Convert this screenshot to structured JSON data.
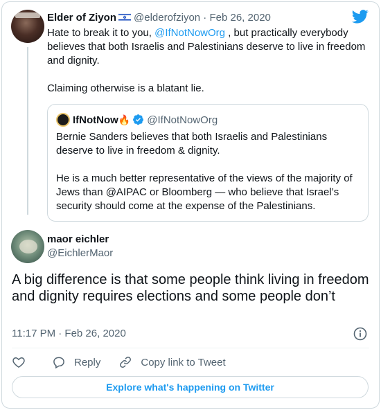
{
  "parent_tweet": {
    "author_name": "Elder of Ziyon",
    "author_flag": "israel-flag-icon",
    "handle": "@elderofziyon",
    "separator": "·",
    "date": "Feb 26, 2020",
    "text_intro": "Hate to break it to you,",
    "mention": "@IfNotNowOrg",
    "text_rest": ", but practically everybody believes that both Israelis and Palestinians deserve to live in freedom and dignity.",
    "text_second": "Claiming otherwise is a blatant lie."
  },
  "quoted_tweet": {
    "author_name": "IfNotNow",
    "author_emoji": "🔥",
    "handle": "@IfNotNowOrg",
    "paragraph_1": "Bernie Sanders believes that both Israelis and Palestinians deserve to live in freedom & dignity.",
    "paragraph_2": "He is a much better representative of the views of the majority of Jews than @AIPAC or Bloomberg — who believe that Israel’s security should come at the expense of the Palestinians."
  },
  "main_tweet": {
    "author_name": "maor eichler",
    "handle": "@EichlerMaor",
    "text": "A big difference is that some people think living in freedom and dignity requires elections and some people don’t",
    "timestamp": "11:17 PM · Feb 26, 2020"
  },
  "actions": {
    "reply_label": "Reply",
    "copy_link_label": "Copy link to Tweet"
  },
  "explore_label": "Explore what's happening on Twitter",
  "colors": {
    "accent": "#1d9bf0",
    "text": "#0f1419",
    "muted": "#536471",
    "border": "#cfd9de"
  }
}
